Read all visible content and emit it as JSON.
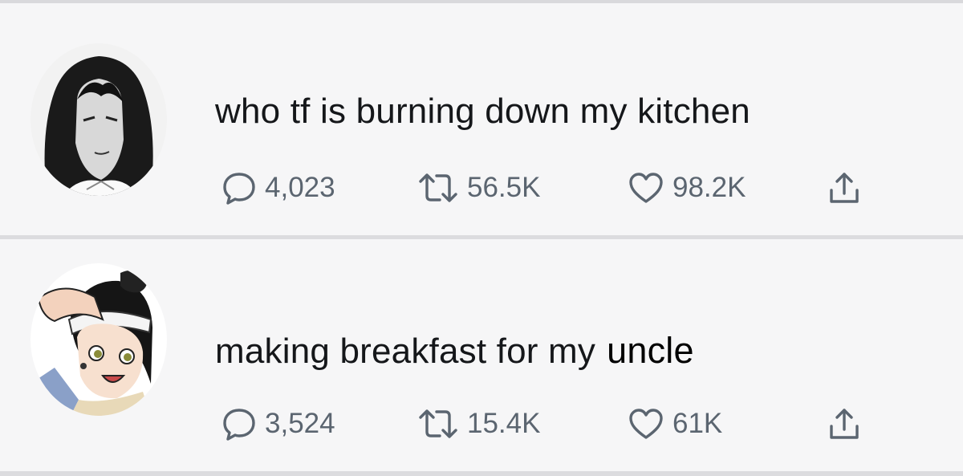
{
  "tweets": [
    {
      "avatar_icon": "long-haired-character-avatar",
      "text": "who tf is burning down my kitchen",
      "edited_word": "",
      "replies": "4,023",
      "retweets": "56.5K",
      "likes": "98.2K"
    },
    {
      "avatar_icon": "headband-character-avatar",
      "text": "making breakfast for my",
      "edited_word": "uncle",
      "replies": "3,524",
      "retweets": "15.4K",
      "likes": "61K"
    }
  ],
  "colors": {
    "background": "#f6f6f7",
    "text": "#15171a",
    "icon": "#5b6570"
  },
  "icons": {
    "reply": "speech-bubble-icon",
    "retweet": "retweet-arrows-icon",
    "like": "heart-outline-icon",
    "share": "share-upload-icon"
  }
}
